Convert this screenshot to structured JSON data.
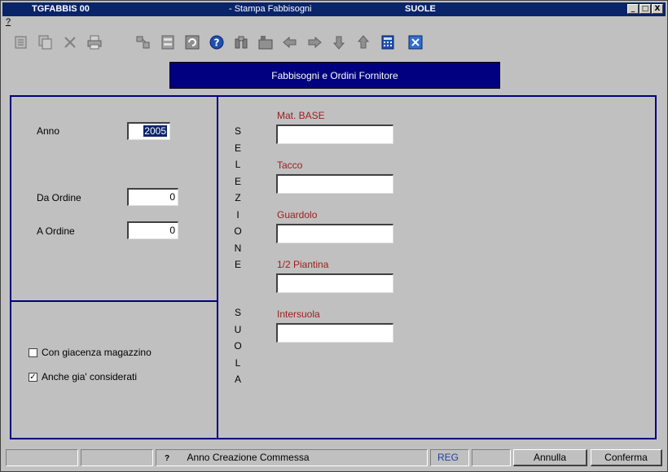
{
  "window": {
    "title_left": "TGFABBIS 00",
    "title_mid": "- Stampa Fabbisogni",
    "title_right": "SUOLE",
    "btn_min": "_",
    "btn_max": "□",
    "btn_close": "X"
  },
  "menu": {
    "help": "?"
  },
  "banner": "Fabbisogni e Ordini Fornitore",
  "left": {
    "anno_label": "Anno",
    "anno_value": "2005",
    "da_ordine_label": "Da Ordine",
    "da_ordine_value": "0",
    "a_ordine_label": "A Ordine",
    "a_ordine_value": "0",
    "chk1_label": "Con giacenza magazzino",
    "chk1_checked": false,
    "chk2_label": "Anche gia' considerati",
    "chk2_checked": true
  },
  "vertical_selezione": [
    "S",
    "E",
    "L",
    "E",
    "Z",
    "I",
    "O",
    "N",
    "E"
  ],
  "vertical_suola": [
    "S",
    "U",
    "O",
    "L",
    "A"
  ],
  "right": {
    "mat_base": "Mat. BASE",
    "tacco": "Tacco",
    "guardolo": "Guardolo",
    "piantina": "1/2 Piantina",
    "intersuola": "Intersuola"
  },
  "status": {
    "help_icon": "?",
    "message": "Anno Creazione Commessa",
    "mode": "REG",
    "annulla": "Annulla",
    "conferma": "Conferma"
  },
  "colors": {
    "titlebar": "#0a246a",
    "banner": "#000080",
    "panel_border": "#000080",
    "field_label_red": "#9c1c1c"
  }
}
